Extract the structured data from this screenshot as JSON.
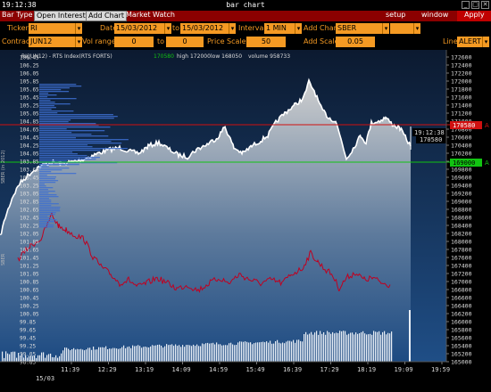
{
  "titlebar": {
    "time": "19:12:38",
    "title": "bar chart",
    "win_icons": [
      "_",
      "▢",
      "✕"
    ]
  },
  "menu": {
    "items": [
      "Bar Type",
      "Open Interest",
      "Add Chart",
      "Market Watch"
    ],
    "right": [
      "setup",
      "window",
      "Apply"
    ]
  },
  "controls": {
    "ticker_label": "Ticker",
    "ticker_value": "RI",
    "date_label": "Date",
    "date_from": "15/03/2012",
    "to_label": "to",
    "date_to": "15/03/2012",
    "interval_label": "Interval",
    "interval_value": "1 MIN",
    "add_chart_label": "Add Chart",
    "add_chart_value": "SBER",
    "contract_label": "Contract",
    "contract_value": "JUN12",
    "vol_range_label": "Vol range",
    "vol_from": "0",
    "vol_to_label": "to",
    "vol_to": "0",
    "price_scale_label": "Price Scale",
    "price_scale_value": "50",
    "add_scale_label": "Add Scale",
    "add_scale_value": "0.05",
    "line_label": "Line",
    "line_value": "ALERT"
  },
  "legend": {
    "instrument": "RI(JUN12) - RTS Index(RTS FORTS)",
    "last": "170580",
    "high": "high 172000",
    "low": "low 168050",
    "volume": "volume 958733"
  },
  "left_axis_label": "SBER (in 2012)",
  "left_axis_sub": "SBER",
  "right_ticks": [
    "172600",
    "172400",
    "172200",
    "172000",
    "171800",
    "171600",
    "171400",
    "171200",
    "171000",
    "170800",
    "170600",
    "170400",
    "170200",
    "170000",
    "169800",
    "169600",
    "169400",
    "169200",
    "169000",
    "168800",
    "168600",
    "168400",
    "168200",
    "168000",
    "167800",
    "167600",
    "167400",
    "167200",
    "167000",
    "166800",
    "166600",
    "166400",
    "166200",
    "166000",
    "165800",
    "165600",
    "165400",
    "165200",
    "165000"
  ],
  "left_ticks": [
    "106.45",
    "106.25",
    "106.05",
    "105.85",
    "105.65",
    "105.45",
    "105.25",
    "105.05",
    "104.85",
    "104.65",
    "104.45",
    "104.25",
    "104.05",
    "103.85",
    "103.65",
    "103.45",
    "103.25",
    "103.05",
    "102.85",
    "102.65",
    "102.45",
    "102.25",
    "102.05",
    "101.85",
    "101.65",
    "101.45",
    "101.25",
    "101.05",
    "100.85",
    "100.65",
    "100.45",
    "100.25",
    "100.05",
    "99.85",
    "99.65",
    "99.45",
    "99.25",
    "99.05",
    "98.85"
  ],
  "x_ticks": [
    "11:39",
    "12:29",
    "13:19",
    "14:09",
    "14:59",
    "15:49",
    "16:39",
    "17:29",
    "18:19",
    "19:09",
    "19:59"
  ],
  "x_date": "15/03",
  "alerts": {
    "red_value": "170580",
    "green_value": "169000",
    "red_tag": "A",
    "green_tag": "A"
  },
  "cursor": {
    "time": "19:12:38",
    "price": "170580"
  },
  "colors": {
    "menu_bg": "#8b0000",
    "field": "#f59a23",
    "area_top": "#c8c8c8",
    "area_bottom": "#1e4a80",
    "red_line": "#c00020",
    "volume": "#ffffff"
  }
}
